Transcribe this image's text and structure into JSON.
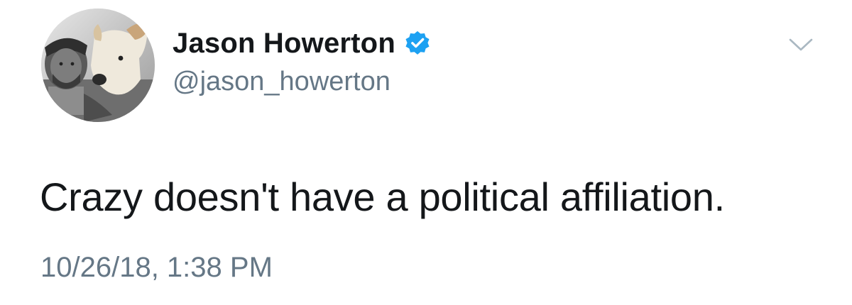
{
  "tweet": {
    "author": {
      "display_name": "Jason Howerton",
      "handle": "@jason_howerton",
      "verified": true,
      "avatar_icon": "profile-photo-man-with-dog"
    },
    "text": "Crazy doesn't have a political affiliation.",
    "timestamp": "10/26/18, 1:38 PM",
    "menu_icon": "chevron-down-icon"
  },
  "colors": {
    "text_primary": "#14171a",
    "text_secondary": "#657786",
    "verified_blue": "#1da1f2",
    "caret_gray": "#aab8c2",
    "background": "#ffffff"
  }
}
